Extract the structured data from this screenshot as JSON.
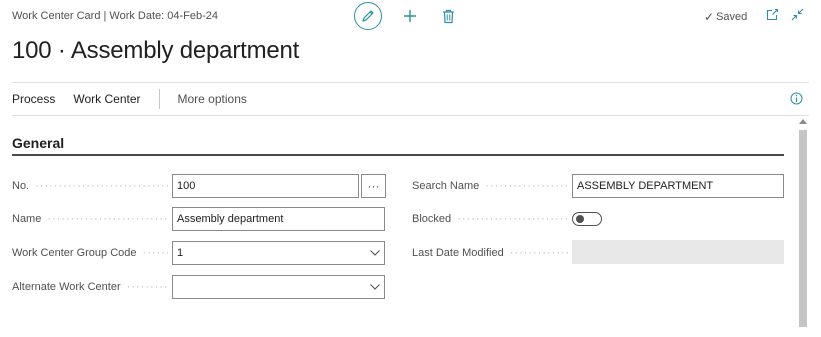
{
  "header": {
    "meta": "Work Center Card | Work Date: 04-Feb-24",
    "title": "100 · Assembly department",
    "saved_label": "Saved"
  },
  "actionbar": {
    "process": "Process",
    "work_center": "Work Center",
    "more_options": "More options"
  },
  "section": {
    "title": "General"
  },
  "fields": {
    "no": {
      "label": "No.",
      "value": "100"
    },
    "name": {
      "label": "Name",
      "value": "Assembly department"
    },
    "group_code": {
      "label": "Work Center Group Code",
      "value": "1"
    },
    "alternate": {
      "label": "Alternate Work Center",
      "value": ""
    },
    "search_name": {
      "label": "Search Name",
      "value": "ASSEMBLY DEPARTMENT"
    },
    "blocked": {
      "label": "Blocked",
      "value": false
    },
    "last_modified": {
      "label": "Last Date Modified",
      "value": ""
    }
  },
  "icons": {
    "edit": "pencil-icon",
    "new": "plus-icon",
    "delete": "trash-icon",
    "saved": "check-icon",
    "open_new_window": "open-new-window-icon",
    "collapse": "collapse-icon",
    "info": "info-icon"
  },
  "colors": {
    "accent": "#2d8fa0",
    "field_border": "#8a8a8a",
    "readonly_bg": "#e8e8e8"
  }
}
